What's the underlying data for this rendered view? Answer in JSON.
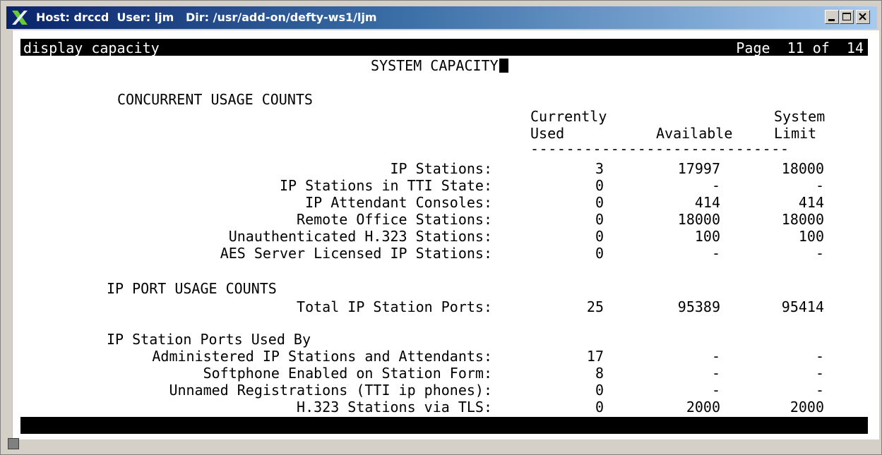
{
  "window": {
    "title": "Host: drccd  User: ljm   Dir: /usr/add-on/defty-ws1/ljm",
    "buttons": [
      "minimize-icon",
      "maximize-icon",
      "close-icon"
    ]
  },
  "status_line": {
    "command": "display capacity",
    "page": "Page  11 of  14"
  },
  "screen_title": "SYSTEM CAPACITY",
  "concurrent": {
    "heading": "CONCURRENT USAGE COUNTS",
    "col_used_1": "Currently",
    "col_used_2": "Used",
    "col_available": "Available",
    "col_limit_1": "System",
    "col_limit_2": "Limit",
    "separator": "-----------------------------",
    "rows": [
      {
        "label": "IP Stations:",
        "used": "3",
        "available": "17997",
        "limit": "18000"
      },
      {
        "label": "IP Stations in TTI State:",
        "used": "0",
        "available": "-",
        "limit": "-"
      },
      {
        "label": "IP Attendant Consoles:",
        "used": "0",
        "available": "414",
        "limit": "414"
      },
      {
        "label": "Remote Office Stations:",
        "used": "0",
        "available": "18000",
        "limit": "18000"
      },
      {
        "label": "Unauthenticated H.323 Stations:",
        "used": "0",
        "available": "100",
        "limit": "100"
      },
      {
        "label": "AES Server Licensed IP Stations:",
        "used": "0",
        "available": "-",
        "limit": "-"
      }
    ]
  },
  "port_usage": {
    "heading": "IP PORT USAGE COUNTS",
    "rows": [
      {
        "label": "Total IP Station Ports:",
        "used": "25",
        "available": "95389",
        "limit": "95414"
      }
    ]
  },
  "ports_used_by": {
    "heading": "IP Station Ports Used By",
    "rows": [
      {
        "label": "Administered IP Stations and Attendants:",
        "used": "17",
        "available": "-",
        "limit": "-"
      },
      {
        "label": "Softphone Enabled on Station Form:",
        "used": "8",
        "available": "-",
        "limit": "-"
      },
      {
        "label": "Unnamed Registrations (TTI ip phones):",
        "used": "0",
        "available": "-",
        "limit": "-"
      },
      {
        "label": "H.323 Stations via TLS:",
        "used": "0",
        "available": "2000",
        "limit": "2000"
      }
    ]
  }
}
